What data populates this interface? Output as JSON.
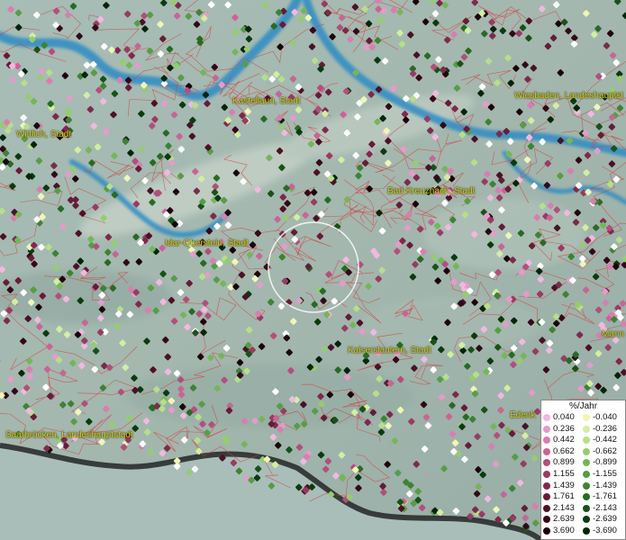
{
  "cities": [
    {
      "name": "Wittlich, Stadt"
    },
    {
      "name": "Kastellaun, Stadt"
    },
    {
      "name": "Wiesbaden, Landeshauptst"
    },
    {
      "name": "Bad Kreuznach, Stadt"
    },
    {
      "name": "Idar-Oberstein, Stadt"
    },
    {
      "name": "Kaiserslautern, Stadt"
    },
    {
      "name": "Mann"
    },
    {
      "name": "Edenk"
    },
    {
      "name": "Saarbrücken, Landeshauptstadt"
    }
  ],
  "legend": {
    "title": "%/Jahr",
    "positive": [
      {
        "value": "0.040",
        "color": "#f2b8e0"
      },
      {
        "value": "0.236",
        "color": "#e79acb"
      },
      {
        "value": "0.442",
        "color": "#d97eb0"
      },
      {
        "value": "0.662",
        "color": "#c86595"
      },
      {
        "value": "0.899",
        "color": "#b24f7b"
      },
      {
        "value": "1.155",
        "color": "#983b63"
      },
      {
        "value": "1.439",
        "color": "#7e2a4c"
      },
      {
        "value": "1.761",
        "color": "#651c38"
      },
      {
        "value": "2.143",
        "color": "#4c1127"
      },
      {
        "value": "2.639",
        "color": "#340818"
      },
      {
        "value": "3.690",
        "color": "#1c030b"
      }
    ],
    "negative": [
      {
        "value": "-0.040",
        "color": "#eef6b8"
      },
      {
        "value": "-0.236",
        "color": "#d3eea0"
      },
      {
        "value": "-0.442",
        "color": "#b6df88"
      },
      {
        "value": "-0.662",
        "color": "#96cc70"
      },
      {
        "value": "-0.899",
        "color": "#75b659"
      },
      {
        "value": "-1.155",
        "color": "#579d45"
      },
      {
        "value": "-1.439",
        "color": "#3d8333"
      },
      {
        "value": "-1.761",
        "color": "#296a24"
      },
      {
        "value": "-2.143",
        "color": "#185218"
      },
      {
        "value": "-2.639",
        "color": "#0b3b0e"
      },
      {
        "value": "-3.690",
        "color": "#042507"
      }
    ]
  }
}
